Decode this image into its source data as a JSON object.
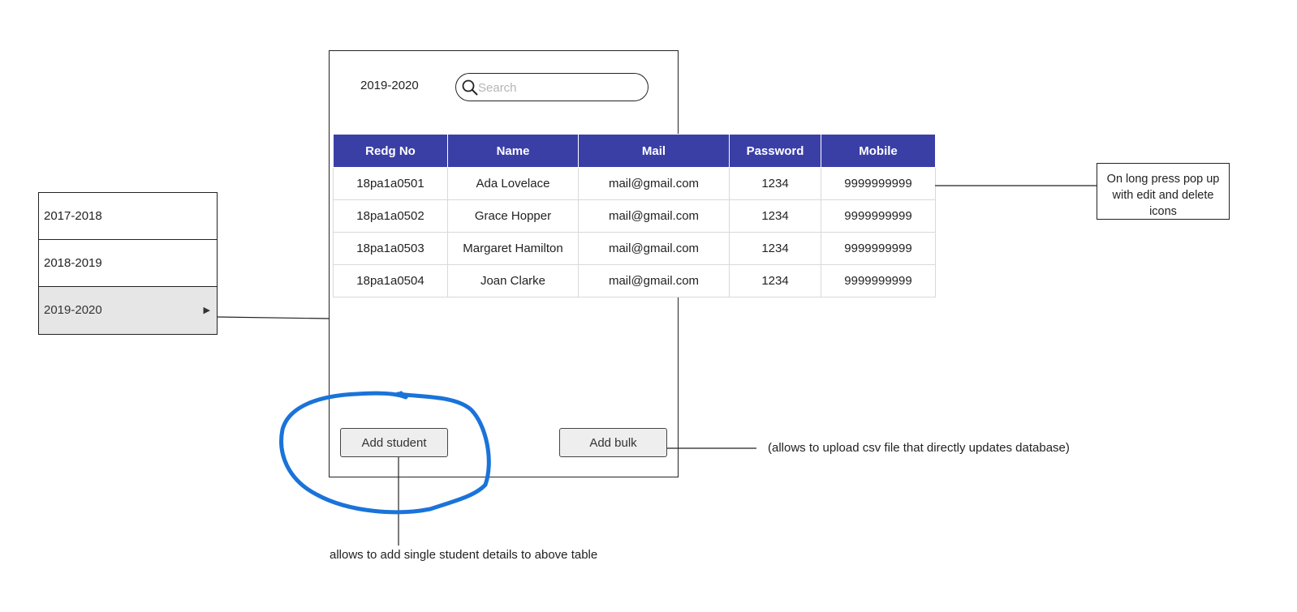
{
  "year_list": {
    "items": [
      {
        "label": "2017-2018",
        "selected": false
      },
      {
        "label": "2018-2019",
        "selected": false
      },
      {
        "label": "2019-2020",
        "selected": true
      }
    ],
    "selected_arrow": "▶"
  },
  "phone": {
    "year_title": "2019-2020",
    "search": {
      "placeholder": "Search",
      "value": "",
      "icon": "search-icon"
    },
    "table": {
      "header_color": "#3a3fa6",
      "columns": [
        "Redg No",
        "Name",
        "Mail",
        "Password",
        "Mobile"
      ],
      "rows": [
        {
          "redg_no": "18pa1a0501",
          "name": "Ada Lovelace",
          "mail": "mail@gmail.com",
          "password": "1234",
          "mobile": "9999999999"
        },
        {
          "redg_no": "18pa1a0502",
          "name": "Grace Hopper",
          "mail": "mail@gmail.com",
          "password": "1234",
          "mobile": "9999999999"
        },
        {
          "redg_no": "18pa1a0503",
          "name": "Margaret Hamilton",
          "mail": "mail@gmail.com",
          "password": "1234",
          "mobile": "9999999999"
        },
        {
          "redg_no": "18pa1a0504",
          "name": "Joan Clarke",
          "mail": "mail@gmail.com",
          "password": "1234",
          "mobile": "9999999999"
        }
      ]
    },
    "buttons": {
      "add_student": "Add student",
      "add_bulk": "Add bulk"
    }
  },
  "annotations": {
    "long_press_note": "On long press pop up with edit and delete icons",
    "bulk_note": "(allows to upload csv file that directly updates database)",
    "single_note": "allows to add single student details to above table",
    "highlight_color": "#1a73d9"
  }
}
